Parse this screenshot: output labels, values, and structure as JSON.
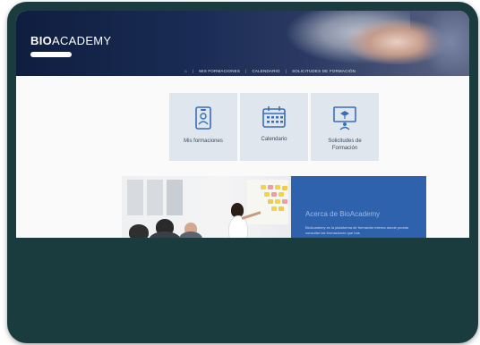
{
  "site": {
    "logo_bold": "BIO",
    "logo_regular": "ACADEMY"
  },
  "nav": {
    "items": [
      "MIS FORMACIONES",
      "CALENDARIO",
      "SOLICITUDES DE FORMACIÓN"
    ]
  },
  "tiles": [
    {
      "label": "Mis formaciones",
      "icon": "id-badge-icon"
    },
    {
      "label": "Calendario",
      "icon": "calendar-icon"
    },
    {
      "label": "Solicitudes de Formación",
      "icon": "presentation-icon"
    }
  ],
  "banner": {
    "title": "Acerca de BioAcademy",
    "text": "BioAcademy es la plataforma de formación interna donde podrás consultar las formaciones que has"
  },
  "colors": {
    "hero_dark": "#0f1e3f",
    "tile_bg": "#dfe6ee",
    "banner_blue": "#2f62ad",
    "device_frame": "#1b3c3f",
    "icon_blue": "#3a6fb5"
  }
}
